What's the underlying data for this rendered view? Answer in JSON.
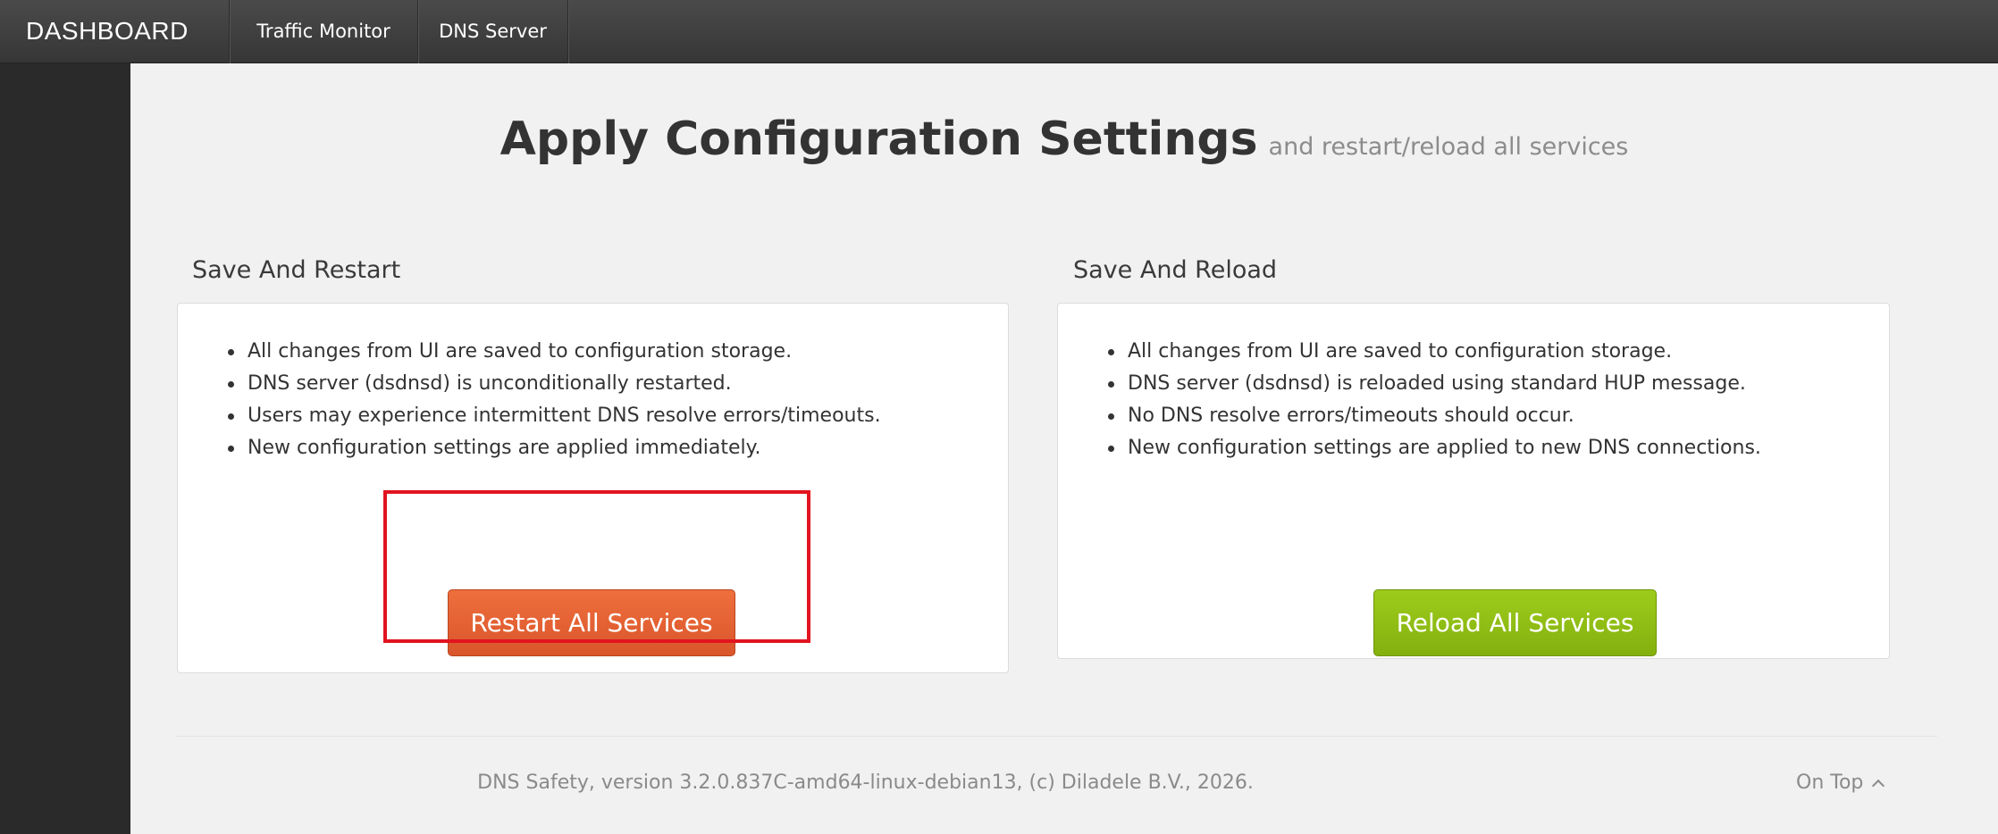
{
  "navbar": {
    "brand": "DASHBOARD",
    "items": [
      {
        "label": "Traffic Monitor"
      },
      {
        "label": "DNS Server"
      }
    ]
  },
  "page": {
    "title": "Apply Configuration Settings",
    "subtitle": "and restart/reload all services"
  },
  "restart_section": {
    "label": "Save And Restart",
    "bullets": [
      "All changes from UI are saved to configuration storage.",
      "DNS server (dsdnsd) is unconditionally restarted.",
      "Users may experience intermittent DNS resolve errors/timeouts.",
      "New configuration settings are applied immediately."
    ],
    "button_label": "Restart All Services",
    "button_color": "#e2612f"
  },
  "reload_section": {
    "label": "Save And Reload",
    "bullets": [
      "All changes from UI are saved to configuration storage.",
      "DNS server (dsdnsd) is reloaded using standard HUP message.",
      "No DNS resolve errors/timeouts should occur.",
      "New configuration settings are applied to new DNS connections."
    ],
    "button_label": "Reload All Services",
    "button_color": "#8fbd12"
  },
  "highlight_color": "#e1141f",
  "footer": {
    "text": "DNS Safety, version 3.2.0.837C-amd64-linux-debian13, (c) Diladele B.V., 2026.",
    "on_top_label": "On Top",
    "on_top_icon": "chevron-up-icon"
  }
}
